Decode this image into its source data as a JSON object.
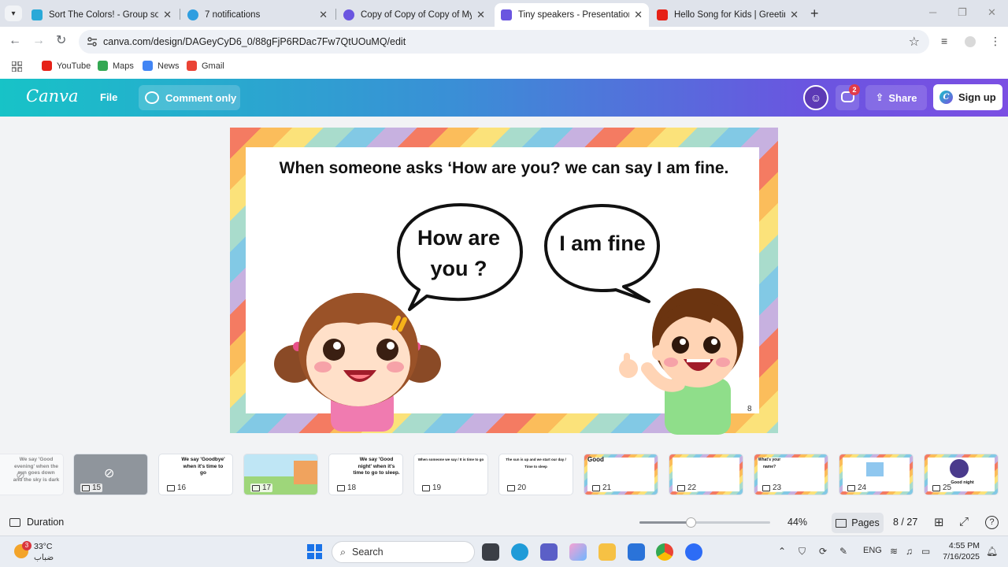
{
  "browser": {
    "tabs": [
      {
        "title": "Sort The Colors! - Group sort",
        "color": "#2aa9d8"
      },
      {
        "title": "7 notifications",
        "color": "#2f9ee0"
      },
      {
        "title": "Copy of Copy of Copy of My ro",
        "color": "#6a55e0"
      },
      {
        "title": "Tiny speakers - Presentation",
        "color": "#6a55e0"
      },
      {
        "title": "Hello Song for Kids | Greeting S",
        "color": "#e62117"
      }
    ],
    "new_tab": "+",
    "url": "canva.com/design/DAGeyCyD6_0/88gFjP6RDac7Fw7QtUOuMQ/edit",
    "bookmarks": [
      {
        "label": "YouTube",
        "color": "#e62117"
      },
      {
        "label": "Maps",
        "color": "#34a853"
      },
      {
        "label": "News",
        "color": "#4285f4"
      },
      {
        "label": "Gmail",
        "color": "#ea4335"
      }
    ]
  },
  "canva": {
    "logo": "Canva",
    "file_label": "File",
    "comment_label": "Comment only",
    "notification_count": "2",
    "share_label": "Share",
    "signup_label": "Sign up"
  },
  "slide": {
    "title": "When someone asks ‘How are you? we can say I am fine.",
    "bubble_left_line1": "How are",
    "bubble_left_line2": "you ?",
    "bubble_right": "I am fine",
    "page_number": "8"
  },
  "thumbnails": [
    {
      "num": "",
      "text": "We say 'Good evening' when the sun goes down and the sky is dark",
      "style": "faded"
    },
    {
      "num": "15",
      "text": "",
      "style": "gray"
    },
    {
      "num": "16",
      "text": "We say 'Goodbye' when it's time to go",
      "style": "white"
    },
    {
      "num": "17",
      "text": "",
      "style": "scene"
    },
    {
      "num": "18",
      "text": "We say 'Good night' when it's time to go to sleep.",
      "style": "white"
    },
    {
      "num": "19",
      "text": "When someone we say / It is time to go",
      "style": "white"
    },
    {
      "num": "20",
      "text": "The sun is up and we start our day / Time to sleep",
      "style": "white"
    },
    {
      "num": "21",
      "text": "Good",
      "style": "rainbow"
    },
    {
      "num": "22",
      "text": "",
      "style": "rainbow"
    },
    {
      "num": "23",
      "text": "What's your name?",
      "style": "rainbow"
    },
    {
      "num": "24",
      "text": "",
      "style": "rainbow"
    },
    {
      "num": "25",
      "text": "Good night",
      "style": "rainbow"
    }
  ],
  "footer": {
    "duration_label": "Duration",
    "zoom": "44%",
    "zoom_fraction": 0.39,
    "pages_label": "Pages",
    "page_count": "8 / 27"
  },
  "taskbar": {
    "weather_badge": "3",
    "temperature": "33°C",
    "condition": "ضباب",
    "search_label": "Search",
    "language": "ENG",
    "time": "4:55 PM",
    "date": "7/16/2025"
  }
}
